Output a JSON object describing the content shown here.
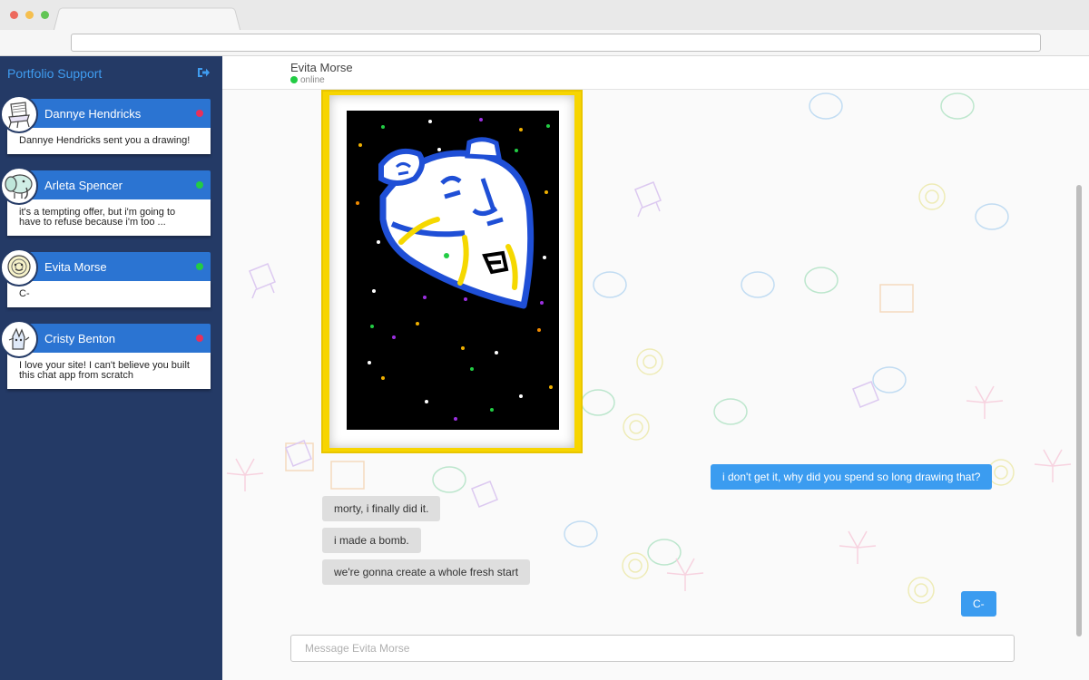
{
  "sidebar": {
    "title": "Portfolio Support",
    "logout_icon": "sign-out-icon",
    "contacts": [
      {
        "name": "Dannye Hendricks",
        "preview": "Dannye Hendricks sent you a drawing!",
        "status_color": "#e8305a",
        "avatar_icon": "lawn-chair-avatar-icon"
      },
      {
        "name": "Arleta Spencer",
        "preview": "it's a tempting offer, but i'm going to have to refuse because i'm too ...",
        "status_color": "#22cc44",
        "avatar_icon": "elephant-avatar-icon"
      },
      {
        "name": "Evita Morse",
        "preview": "C-",
        "status_color": "#22cc44",
        "avatar_icon": "snail-avatar-icon"
      },
      {
        "name": "Cristy Benton",
        "preview": "I love your site! I can't believe you built this chat app from scratch",
        "status_color": "#e8305a",
        "avatar_icon": "hand-drawn-avatar-icon"
      }
    ]
  },
  "chat": {
    "contact_name": "Evita Morse",
    "status": "online",
    "drawing_icon": "spaceship-drawing-image",
    "messages": [
      {
        "direction": "out",
        "text": "i don't get it, why did you spend so long drawing that?"
      },
      {
        "direction": "in",
        "text": "morty, i finally did it."
      },
      {
        "direction": "in",
        "text": "i made a bomb."
      },
      {
        "direction": "in",
        "text": "we're gonna create a whole fresh start"
      },
      {
        "direction": "out",
        "text": "C-"
      }
    ],
    "composer_placeholder": "Message Evita Morse"
  },
  "colors": {
    "sidebar_bg": "#243a66",
    "accent": "#2b74d2",
    "outgoing_bubble": "#3b9cf0",
    "incoming_bubble": "#dedede",
    "online": "#22cc44",
    "offline": "#e8305a",
    "frame": "#f7d500"
  }
}
